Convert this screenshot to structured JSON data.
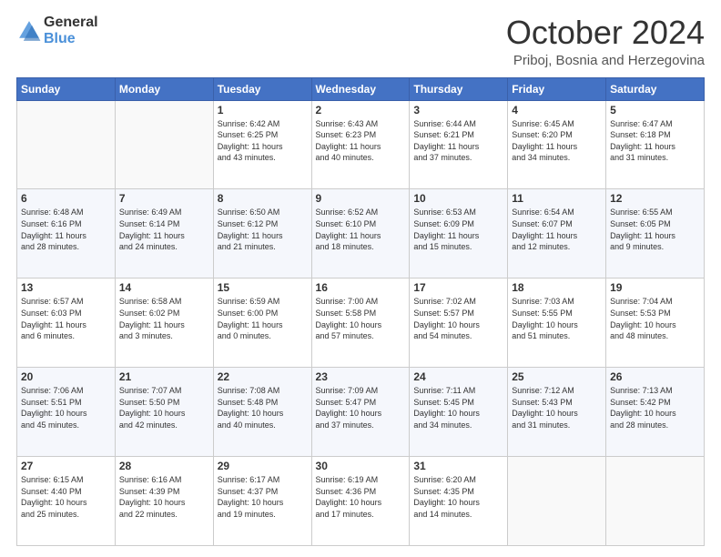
{
  "logo": {
    "line1": "General",
    "line2": "Blue"
  },
  "header": {
    "month": "October 2024",
    "location": "Priboj, Bosnia and Herzegovina"
  },
  "days_of_week": [
    "Sunday",
    "Monday",
    "Tuesday",
    "Wednesday",
    "Thursday",
    "Friday",
    "Saturday"
  ],
  "weeks": [
    [
      {
        "day": "",
        "content": ""
      },
      {
        "day": "",
        "content": ""
      },
      {
        "day": "1",
        "content": "Sunrise: 6:42 AM\nSunset: 6:25 PM\nDaylight: 11 hours\nand 43 minutes."
      },
      {
        "day": "2",
        "content": "Sunrise: 6:43 AM\nSunset: 6:23 PM\nDaylight: 11 hours\nand 40 minutes."
      },
      {
        "day": "3",
        "content": "Sunrise: 6:44 AM\nSunset: 6:21 PM\nDaylight: 11 hours\nand 37 minutes."
      },
      {
        "day": "4",
        "content": "Sunrise: 6:45 AM\nSunset: 6:20 PM\nDaylight: 11 hours\nand 34 minutes."
      },
      {
        "day": "5",
        "content": "Sunrise: 6:47 AM\nSunset: 6:18 PM\nDaylight: 11 hours\nand 31 minutes."
      }
    ],
    [
      {
        "day": "6",
        "content": "Sunrise: 6:48 AM\nSunset: 6:16 PM\nDaylight: 11 hours\nand 28 minutes."
      },
      {
        "day": "7",
        "content": "Sunrise: 6:49 AM\nSunset: 6:14 PM\nDaylight: 11 hours\nand 24 minutes."
      },
      {
        "day": "8",
        "content": "Sunrise: 6:50 AM\nSunset: 6:12 PM\nDaylight: 11 hours\nand 21 minutes."
      },
      {
        "day": "9",
        "content": "Sunrise: 6:52 AM\nSunset: 6:10 PM\nDaylight: 11 hours\nand 18 minutes."
      },
      {
        "day": "10",
        "content": "Sunrise: 6:53 AM\nSunset: 6:09 PM\nDaylight: 11 hours\nand 15 minutes."
      },
      {
        "day": "11",
        "content": "Sunrise: 6:54 AM\nSunset: 6:07 PM\nDaylight: 11 hours\nand 12 minutes."
      },
      {
        "day": "12",
        "content": "Sunrise: 6:55 AM\nSunset: 6:05 PM\nDaylight: 11 hours\nand 9 minutes."
      }
    ],
    [
      {
        "day": "13",
        "content": "Sunrise: 6:57 AM\nSunset: 6:03 PM\nDaylight: 11 hours\nand 6 minutes."
      },
      {
        "day": "14",
        "content": "Sunrise: 6:58 AM\nSunset: 6:02 PM\nDaylight: 11 hours\nand 3 minutes."
      },
      {
        "day": "15",
        "content": "Sunrise: 6:59 AM\nSunset: 6:00 PM\nDaylight: 11 hours\nand 0 minutes."
      },
      {
        "day": "16",
        "content": "Sunrise: 7:00 AM\nSunset: 5:58 PM\nDaylight: 10 hours\nand 57 minutes."
      },
      {
        "day": "17",
        "content": "Sunrise: 7:02 AM\nSunset: 5:57 PM\nDaylight: 10 hours\nand 54 minutes."
      },
      {
        "day": "18",
        "content": "Sunrise: 7:03 AM\nSunset: 5:55 PM\nDaylight: 10 hours\nand 51 minutes."
      },
      {
        "day": "19",
        "content": "Sunrise: 7:04 AM\nSunset: 5:53 PM\nDaylight: 10 hours\nand 48 minutes."
      }
    ],
    [
      {
        "day": "20",
        "content": "Sunrise: 7:06 AM\nSunset: 5:51 PM\nDaylight: 10 hours\nand 45 minutes."
      },
      {
        "day": "21",
        "content": "Sunrise: 7:07 AM\nSunset: 5:50 PM\nDaylight: 10 hours\nand 42 minutes."
      },
      {
        "day": "22",
        "content": "Sunrise: 7:08 AM\nSunset: 5:48 PM\nDaylight: 10 hours\nand 40 minutes."
      },
      {
        "day": "23",
        "content": "Sunrise: 7:09 AM\nSunset: 5:47 PM\nDaylight: 10 hours\nand 37 minutes."
      },
      {
        "day": "24",
        "content": "Sunrise: 7:11 AM\nSunset: 5:45 PM\nDaylight: 10 hours\nand 34 minutes."
      },
      {
        "day": "25",
        "content": "Sunrise: 7:12 AM\nSunset: 5:43 PM\nDaylight: 10 hours\nand 31 minutes."
      },
      {
        "day": "26",
        "content": "Sunrise: 7:13 AM\nSunset: 5:42 PM\nDaylight: 10 hours\nand 28 minutes."
      }
    ],
    [
      {
        "day": "27",
        "content": "Sunrise: 6:15 AM\nSunset: 4:40 PM\nDaylight: 10 hours\nand 25 minutes."
      },
      {
        "day": "28",
        "content": "Sunrise: 6:16 AM\nSunset: 4:39 PM\nDaylight: 10 hours\nand 22 minutes."
      },
      {
        "day": "29",
        "content": "Sunrise: 6:17 AM\nSunset: 4:37 PM\nDaylight: 10 hours\nand 19 minutes."
      },
      {
        "day": "30",
        "content": "Sunrise: 6:19 AM\nSunset: 4:36 PM\nDaylight: 10 hours\nand 17 minutes."
      },
      {
        "day": "31",
        "content": "Sunrise: 6:20 AM\nSunset: 4:35 PM\nDaylight: 10 hours\nand 14 minutes."
      },
      {
        "day": "",
        "content": ""
      },
      {
        "day": "",
        "content": ""
      }
    ]
  ]
}
